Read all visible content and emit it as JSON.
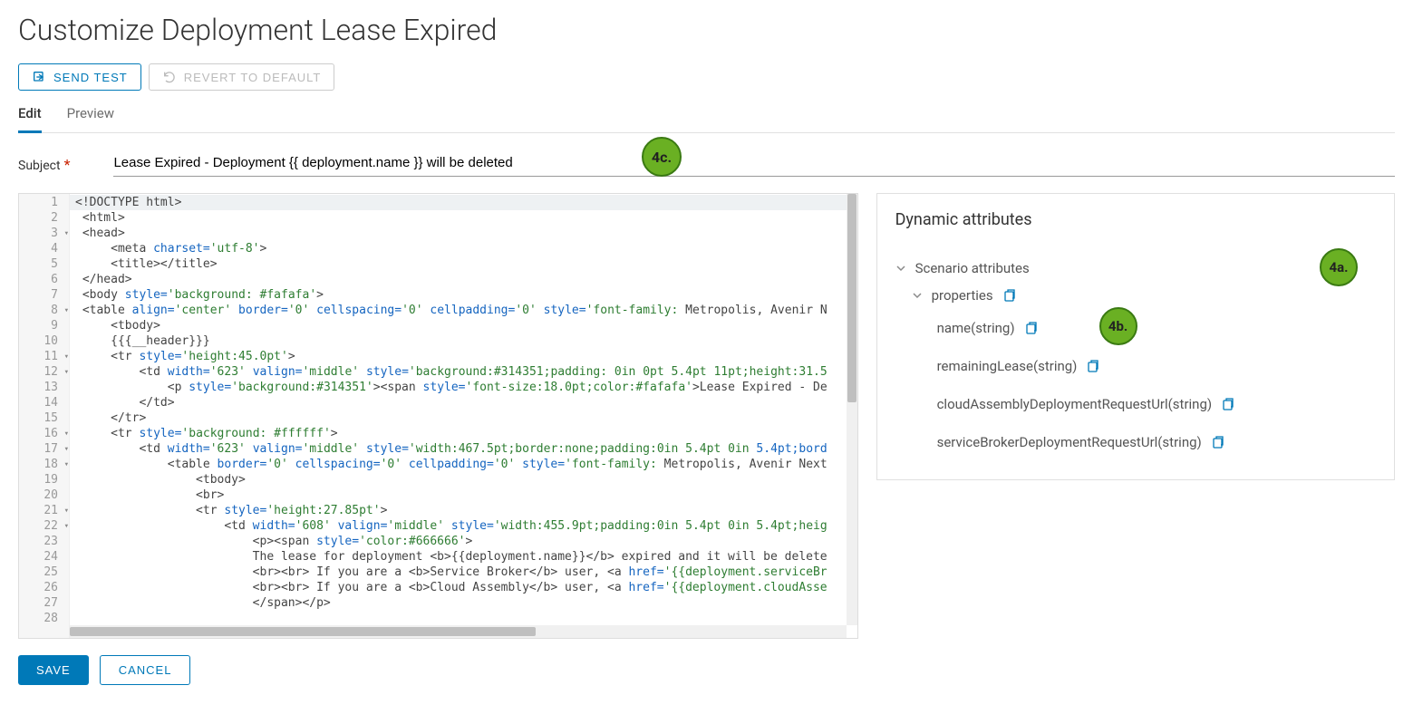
{
  "pageTitle": "Customize Deployment Lease Expired",
  "toolbar": {
    "sendTest": "SEND TEST",
    "revert": "REVERT TO DEFAULT"
  },
  "tabs": {
    "edit": "Edit",
    "preview": "Preview"
  },
  "subject": {
    "label": "Subject",
    "value": "Lease Expired - Deployment {{ deployment.name }} will be deleted"
  },
  "codeLines": [
    {
      "n": 1,
      "fold": false,
      "sel": true,
      "segs": [
        {
          "t": "<!DOCTYPE html>",
          "c": "plain"
        }
      ]
    },
    {
      "n": 2,
      "fold": false,
      "segs": [
        {
          "t": " <html>",
          "c": "plain"
        }
      ]
    },
    {
      "n": 3,
      "fold": true,
      "segs": [
        {
          "t": " <head>",
          "c": "plain"
        }
      ]
    },
    {
      "n": 4,
      "fold": false,
      "segs": [
        {
          "t": "     <meta ",
          "c": "plain"
        },
        {
          "t": "charset=",
          "c": "tag-attr"
        },
        {
          "t": "'utf-8'",
          "c": "attr-val"
        },
        {
          "t": ">",
          "c": "plain"
        }
      ]
    },
    {
      "n": 5,
      "fold": false,
      "segs": [
        {
          "t": "     <title></title>",
          "c": "plain"
        }
      ]
    },
    {
      "n": 6,
      "fold": false,
      "segs": [
        {
          "t": " </head>",
          "c": "plain"
        }
      ]
    },
    {
      "n": 7,
      "fold": false,
      "segs": [
        {
          "t": " <body ",
          "c": "plain"
        },
        {
          "t": "style=",
          "c": "tag-attr"
        },
        {
          "t": "'background: ",
          "c": "attr-val"
        },
        {
          "t": "#fafafa",
          "c": "attr-val"
        },
        {
          "t": "'",
          "c": "attr-val"
        },
        {
          "t": ">",
          "c": "plain"
        }
      ]
    },
    {
      "n": 8,
      "fold": true,
      "segs": [
        {
          "t": " <table ",
          "c": "plain"
        },
        {
          "t": "align=",
          "c": "tag-attr"
        },
        {
          "t": "'center' ",
          "c": "attr-val"
        },
        {
          "t": "border=",
          "c": "tag-attr"
        },
        {
          "t": "'0' ",
          "c": "attr-val"
        },
        {
          "t": "cellspacing=",
          "c": "tag-attr"
        },
        {
          "t": "'0' ",
          "c": "attr-val"
        },
        {
          "t": "cellpadding=",
          "c": "tag-attr"
        },
        {
          "t": "'0' ",
          "c": "attr-val"
        },
        {
          "t": "style=",
          "c": "tag-attr"
        },
        {
          "t": "'font-family: ",
          "c": "attr-val"
        },
        {
          "t": "Metropolis, Avenir N",
          "c": "plain"
        }
      ]
    },
    {
      "n": 9,
      "fold": false,
      "segs": [
        {
          "t": "     <tbody>",
          "c": "plain"
        }
      ]
    },
    {
      "n": 10,
      "fold": false,
      "segs": [
        {
          "t": "     {{{__header}}}",
          "c": "plain"
        }
      ]
    },
    {
      "n": 11,
      "fold": true,
      "segs": [
        {
          "t": "     <tr ",
          "c": "plain"
        },
        {
          "t": "style=",
          "c": "tag-attr"
        },
        {
          "t": "'height:45.0pt'",
          "c": "attr-val"
        },
        {
          "t": ">",
          "c": "plain"
        }
      ]
    },
    {
      "n": 12,
      "fold": true,
      "segs": [
        {
          "t": "         <td ",
          "c": "plain"
        },
        {
          "t": "width=",
          "c": "tag-attr"
        },
        {
          "t": "'623' ",
          "c": "attr-val"
        },
        {
          "t": "valign=",
          "c": "tag-attr"
        },
        {
          "t": "'middle' ",
          "c": "attr-val"
        },
        {
          "t": "style=",
          "c": "tag-attr"
        },
        {
          "t": "'background:",
          "c": "attr-val"
        },
        {
          "t": "#314351",
          "c": "attr-val"
        },
        {
          "t": ";padding: 0in 0pt 5.4pt 11pt;height:31.5",
          "c": "attr-val"
        }
      ]
    },
    {
      "n": 13,
      "fold": false,
      "segs": [
        {
          "t": "             <p ",
          "c": "plain"
        },
        {
          "t": "style=",
          "c": "tag-attr"
        },
        {
          "t": "'background:",
          "c": "attr-val"
        },
        {
          "t": "#314351'",
          "c": "attr-val"
        },
        {
          "t": "><span ",
          "c": "plain"
        },
        {
          "t": "style=",
          "c": "tag-attr"
        },
        {
          "t": "'font-size:18.0pt;color:",
          "c": "attr-val"
        },
        {
          "t": "#fafafa'",
          "c": "attr-val"
        },
        {
          "t": ">Lease Expired - De",
          "c": "plain"
        }
      ]
    },
    {
      "n": 14,
      "fold": false,
      "segs": [
        {
          "t": "         </td>",
          "c": "plain"
        }
      ]
    },
    {
      "n": 15,
      "fold": false,
      "segs": [
        {
          "t": "     </tr>",
          "c": "plain"
        }
      ]
    },
    {
      "n": 16,
      "fold": true,
      "segs": [
        {
          "t": "     <tr ",
          "c": "plain"
        },
        {
          "t": "style=",
          "c": "tag-attr"
        },
        {
          "t": "'background: ",
          "c": "attr-val"
        },
        {
          "t": "#ffffff'",
          "c": "attr-val"
        },
        {
          "t": ">",
          "c": "plain"
        }
      ]
    },
    {
      "n": 17,
      "fold": true,
      "segs": [
        {
          "t": "         <td ",
          "c": "plain"
        },
        {
          "t": "width=",
          "c": "tag-attr"
        },
        {
          "t": "'623' ",
          "c": "attr-val"
        },
        {
          "t": "valign=",
          "c": "tag-attr"
        },
        {
          "t": "'middle' ",
          "c": "attr-val"
        },
        {
          "t": "style=",
          "c": "tag-attr"
        },
        {
          "t": "'width:467.5pt;border:none;padding:0in 5.4pt 0in ",
          "c": "attr-val"
        },
        {
          "t": "5.4pt;bord",
          "c": "tag-attr"
        }
      ]
    },
    {
      "n": 18,
      "fold": true,
      "segs": [
        {
          "t": "             <table ",
          "c": "plain"
        },
        {
          "t": "border=",
          "c": "tag-attr"
        },
        {
          "t": "'0' ",
          "c": "attr-val"
        },
        {
          "t": "cellspacing=",
          "c": "tag-attr"
        },
        {
          "t": "'0' ",
          "c": "attr-val"
        },
        {
          "t": "cellpadding=",
          "c": "tag-attr"
        },
        {
          "t": "'0' ",
          "c": "attr-val"
        },
        {
          "t": "style=",
          "c": "tag-attr"
        },
        {
          "t": "'font-family: ",
          "c": "attr-val"
        },
        {
          "t": "Metropolis, Avenir Next",
          "c": "plain"
        }
      ]
    },
    {
      "n": 19,
      "fold": false,
      "segs": [
        {
          "t": "                 <tbody>",
          "c": "plain"
        }
      ]
    },
    {
      "n": 20,
      "fold": false,
      "segs": [
        {
          "t": "                 <br>",
          "c": "plain"
        }
      ]
    },
    {
      "n": 21,
      "fold": true,
      "segs": [
        {
          "t": "                 <tr ",
          "c": "plain"
        },
        {
          "t": "style=",
          "c": "tag-attr"
        },
        {
          "t": "'height:27.85pt'",
          "c": "attr-val"
        },
        {
          "t": ">",
          "c": "plain"
        }
      ]
    },
    {
      "n": 22,
      "fold": true,
      "segs": [
        {
          "t": "                     <td ",
          "c": "plain"
        },
        {
          "t": "width=",
          "c": "tag-attr"
        },
        {
          "t": "'608' ",
          "c": "attr-val"
        },
        {
          "t": "valign=",
          "c": "tag-attr"
        },
        {
          "t": "'middle' ",
          "c": "attr-val"
        },
        {
          "t": "style=",
          "c": "tag-attr"
        },
        {
          "t": "'width:455.9pt;padding:0in 5.4pt 0in 5.4pt;heig",
          "c": "attr-val"
        }
      ]
    },
    {
      "n": 23,
      "fold": false,
      "segs": [
        {
          "t": "                         <p><span ",
          "c": "plain"
        },
        {
          "t": "style=",
          "c": "tag-attr"
        },
        {
          "t": "'color:",
          "c": "attr-val"
        },
        {
          "t": "#666666'",
          "c": "attr-val"
        },
        {
          "t": ">",
          "c": "plain"
        }
      ]
    },
    {
      "n": 24,
      "fold": false,
      "segs": [
        {
          "t": "                         The lease for deployment <b>{{deployment.name}}</b> expired and it will be delete",
          "c": "plain"
        }
      ]
    },
    {
      "n": 25,
      "fold": false,
      "segs": [
        {
          "t": "                         <br><br> If you are a <b>Service Broker</b> user, <a ",
          "c": "plain"
        },
        {
          "t": "href=",
          "c": "tag-attr"
        },
        {
          "t": "'{{deployment.serviceBr",
          "c": "attr-val"
        }
      ]
    },
    {
      "n": 26,
      "fold": false,
      "segs": [
        {
          "t": "                         <br><br> If you are a <b>Cloud Assembly</b> user, <a ",
          "c": "plain"
        },
        {
          "t": "href=",
          "c": "tag-attr"
        },
        {
          "t": "'{{deployment.cloudAsse",
          "c": "attr-val"
        }
      ]
    },
    {
      "n": 27,
      "fold": false,
      "segs": [
        {
          "t": "                         </span></p>",
          "c": "plain"
        }
      ]
    },
    {
      "n": 28,
      "fold": false,
      "segs": []
    }
  ],
  "sidePanel": {
    "title": "Dynamic attributes",
    "scenario": "Scenario attributes",
    "properties": "properties",
    "items": [
      "name(string)",
      "remainingLease(string)",
      "cloudAssemblyDeploymentRequestUrl(string)",
      "serviceBrokerDeploymentRequestUrl(string)"
    ]
  },
  "footer": {
    "save": "SAVE",
    "cancel": "CANCEL"
  },
  "callouts": {
    "c4a": "4a.",
    "c4b": "4b.",
    "c4c": "4c."
  }
}
